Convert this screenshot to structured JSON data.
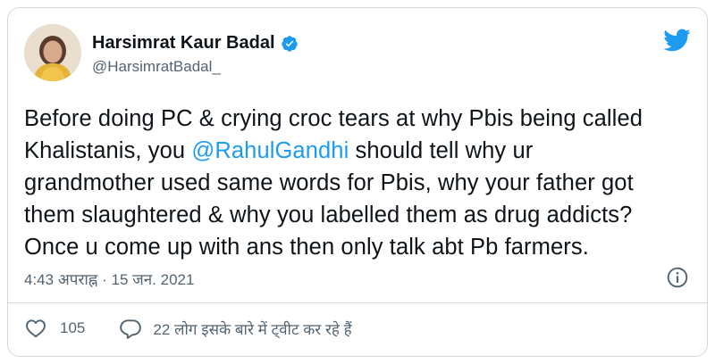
{
  "author": {
    "name": "Harsimrat Kaur Badal",
    "handle": "@HarsimratBadal_"
  },
  "tweet": {
    "lines": [
      "Before doing PC & crying croc tears at why Pbis being called",
      "Khalistanis, you ",
      "@RahulGandhi",
      " should tell why ur",
      "grandmother used same words for Pbis, why your father got",
      "them slaughtered & why you labelled them as drug addicts?",
      "Once u come up with ans then only talk abt Pb farmers."
    ]
  },
  "meta": {
    "time": "4:43 अपराह्न · 15 जन. 2021"
  },
  "actions": {
    "like_count": "105",
    "reply_label": "22 लोग इसके बारे में ट्वीट कर रहे हैं"
  },
  "colors": {
    "accent": "#1d9bf0",
    "secondary_text": "#536471"
  },
  "icons": [
    "verified-badge-icon",
    "twitter-bird-icon",
    "info-icon",
    "heart-icon",
    "reply-bubble-icon"
  ]
}
